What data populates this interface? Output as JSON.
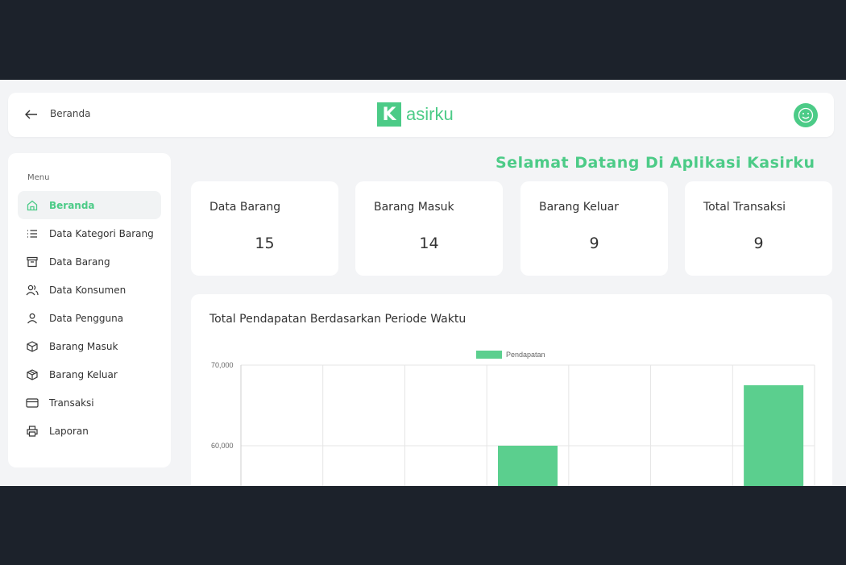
{
  "header": {
    "crumb": "Beranda",
    "logo_letter": "K",
    "logo_text": "asirku"
  },
  "sidebar": {
    "title": "Menu",
    "items": [
      {
        "label": "Beranda",
        "icon": "home-icon",
        "active": true
      },
      {
        "label": "Data Kategori Barang",
        "icon": "list-icon"
      },
      {
        "label": "Data Barang",
        "icon": "archive-icon"
      },
      {
        "label": "Data Konsumen",
        "icon": "users-icon"
      },
      {
        "label": "Data Pengguna",
        "icon": "user-icon"
      },
      {
        "label": "Barang Masuk",
        "icon": "box-icon"
      },
      {
        "label": "Barang Keluar",
        "icon": "box-icon"
      },
      {
        "label": "Transaksi",
        "icon": "card-icon"
      },
      {
        "label": "Laporan",
        "icon": "printer-icon"
      }
    ]
  },
  "welcome": "Selamat Datang Di Aplikasi Kasirku",
  "stats": [
    {
      "label": "Data Barang",
      "value": "15"
    },
    {
      "label": "Barang Masuk",
      "value": "14"
    },
    {
      "label": "Barang Keluar",
      "value": "9"
    },
    {
      "label": "Total Transaksi",
      "value": "9"
    }
  ],
  "colors": {
    "accent": "#4ccb87",
    "bar": "#5bcf8e"
  },
  "chart": {
    "title": "Total Pendapatan Berdasarkan Periode Waktu"
  },
  "chart_data": {
    "type": "bar",
    "title": "Total Pendapatan Berdasarkan Periode Waktu",
    "series": [
      {
        "name": "Pendapatan",
        "values": [
          null,
          null,
          null,
          60000,
          null,
          null,
          67500
        ]
      }
    ],
    "y_ticks": [
      "70,000",
      "60,000"
    ],
    "ylim_visible": [
      55000,
      70000
    ],
    "grid": true,
    "legend": "top-center"
  }
}
